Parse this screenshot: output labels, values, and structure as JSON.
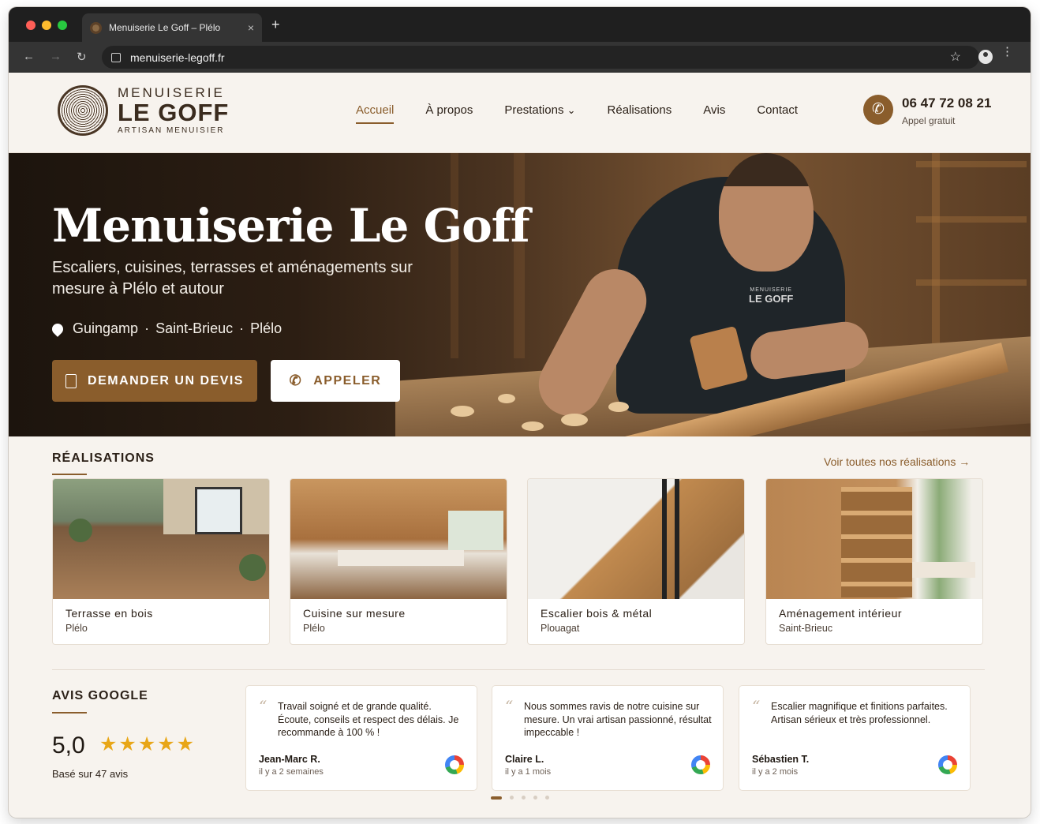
{
  "browser": {
    "tab_title": "Menuiserie Le Goff – Plélo",
    "tab_close": "×",
    "new_tab": "+",
    "url": "menuiserie-legoff.fr",
    "back": "←",
    "forward": "→",
    "reload": "↻",
    "bookmark": "☆",
    "menu": "⋮"
  },
  "logo": {
    "line1": "MENUISERIE",
    "line2": "LE GOFF",
    "line3": "ARTISAN MENUISIER"
  },
  "nav": {
    "items": [
      "Accueil",
      "À propos",
      "Prestations",
      "Réalisations",
      "Avis",
      "Contact"
    ],
    "dropdown_icon": "⌄"
  },
  "phone": {
    "icon": "✆",
    "number": "06 47 72 08 21",
    "subtitle": "Appel gratuit"
  },
  "hero": {
    "title": "Menuiserie Le Goff",
    "subtitle": "Escaliers, cuisines, terrasses et aménagements sur mesure à Plélo et autour",
    "locations": [
      "Guingamp",
      "Saint-Brieuc",
      "Plélo"
    ],
    "separator": "·",
    "shirt_l1": "MENUISERIE",
    "shirt_l2": "LE GOFF",
    "cta_quote": "DEMANDER UN DEVIS",
    "cta_call": "APPELER",
    "call_icon": "✆"
  },
  "realisations": {
    "title": "RÉALISATIONS",
    "see_all": "Voir toutes nos réalisations  →",
    "cards": [
      {
        "title": "Terrasse en bois",
        "location": "Plélo"
      },
      {
        "title": "Cuisine sur mesure",
        "location": "Plélo"
      },
      {
        "title": "Escalier bois & métal",
        "location": "Plouagat"
      },
      {
        "title": "Aménagement intérieur",
        "location": "Saint-Brieuc"
      }
    ]
  },
  "avis": {
    "title": "AVIS GOOGLE",
    "score": "5,0",
    "stars": "★★★★★",
    "based_on": "Basé sur 47 avis",
    "quote_mark": "“",
    "reviews": [
      {
        "text": "Travail soigné et de grande qualité. Écoute, conseils et respect des délais. Je recommande à 100 % !",
        "name": "Jean-Marc R.",
        "when": "il y a 2 semaines"
      },
      {
        "text": "Nous sommes ravis de notre cuisine sur mesure. Un vrai artisan passionné, résultat impeccable !",
        "name": "Claire L.",
        "when": "il y a 1 mois"
      },
      {
        "text": "Escalier magnifique et finitions parfaites. Artisan sérieux et très professionnel.",
        "name": "Sébastien T.",
        "when": "il y a 2 mois"
      }
    ]
  },
  "colors": {
    "accent": "#8a5d2c",
    "dark": "#2c2118",
    "star": "#e8a617"
  }
}
